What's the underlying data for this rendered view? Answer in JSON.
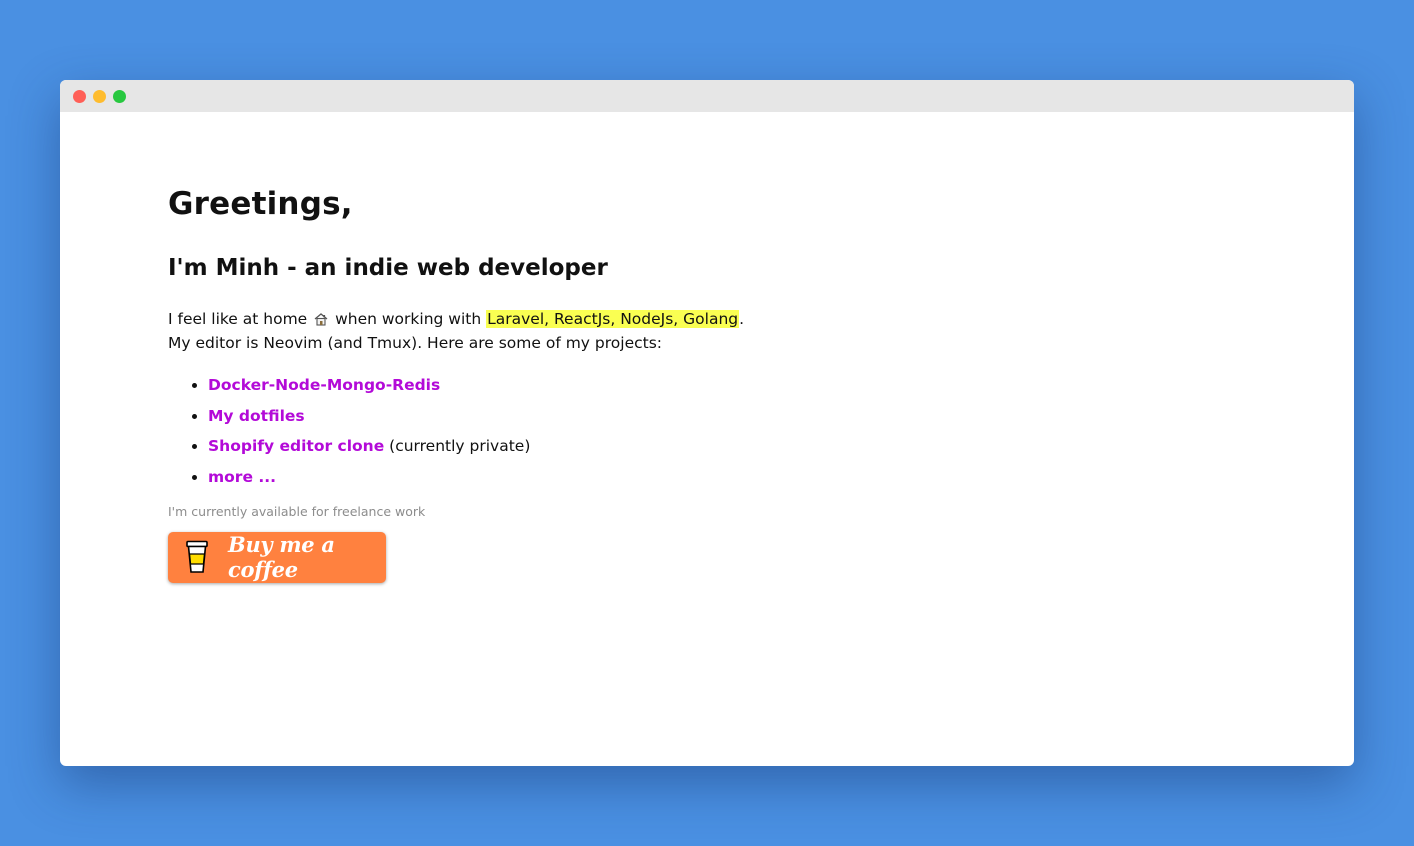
{
  "window": {
    "controls": [
      "close",
      "minimize",
      "maximize"
    ]
  },
  "page": {
    "heading": "Greetings,",
    "subheading": "I'm Minh - an indie web developer",
    "intro_part1": "I feel like at home",
    "intro_part2": "when working with",
    "intro_highlight": "Laravel, ReactJs, NodeJs, Golang",
    "intro_period": ".",
    "intro_line2": "My editor is Neovim (and Tmux). Here are some of my projects:",
    "projects": [
      {
        "label": "Docker-Node-Mongo-Redis",
        "suffix": ""
      },
      {
        "label": "My dotfiles",
        "suffix": ""
      },
      {
        "label": "Shopify editor clone",
        "suffix": " (currently private)"
      },
      {
        "label": "more ...",
        "suffix": ""
      }
    ],
    "freelance_note": "I'm currently available for freelance work",
    "coffee_button": "Buy me a coffee"
  },
  "colors": {
    "background": "#4a90e2",
    "link": "#b30ad8",
    "highlight": "#faff52",
    "coffee_button": "#ff813f"
  },
  "icons": {
    "home": "house-icon",
    "coffee": "coffee-cup-icon"
  }
}
